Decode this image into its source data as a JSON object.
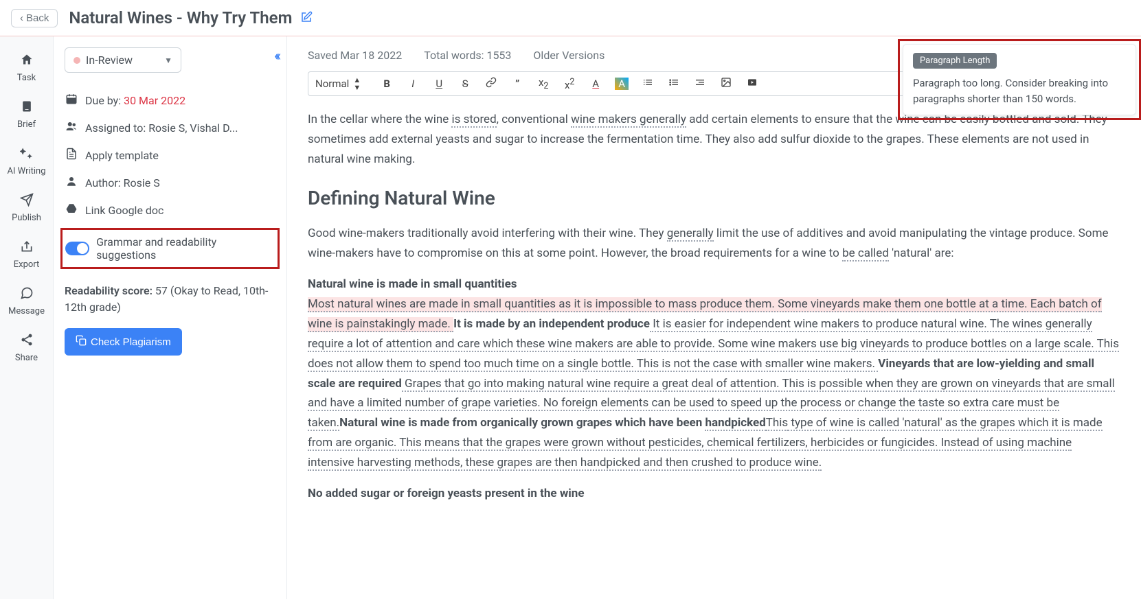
{
  "header": {
    "back_label": "Back",
    "title": "Natural Wines - Why Try Them"
  },
  "iconbar": {
    "task": "Task",
    "brief": "Brief",
    "ai_writing": "AI Writing",
    "publish": "Publish",
    "export": "Export",
    "message": "Message",
    "share": "Share"
  },
  "sidepanel": {
    "status": "In-Review",
    "due_label": "Due by: ",
    "due_date": "30 Mar 2022",
    "assigned_label": "Assigned to: ",
    "assigned_to": "Rosie S, Vishal D...",
    "apply_template": "Apply template",
    "author_label": "Author: ",
    "author": "Rosie S",
    "link_gdoc": "Link Google doc",
    "grammar_toggle": "Grammar and readability suggestions",
    "readability_label": "Readability score: ",
    "readability_value": "57 (Okay to Read, 10th-12th grade)",
    "plagiarism": "Check Plagiarism"
  },
  "editor_meta": {
    "saved": "Saved Mar 18 2022",
    "total_words": "Total words: 1553",
    "older_versions": "Older Versions"
  },
  "toolbar": {
    "style": "Normal"
  },
  "content": {
    "p1_a": "In the cellar where the wine ",
    "p1_b": "is stored",
    "p1_c": ", conventional ",
    "p1_d": "wine makers generally",
    "p1_e": " add certain elements to ensure that the wine can be easily bottled and sold. They sometimes add external yeasts and sugar to increase the fermentation time. They also add sulfur dioxide to the grapes. These elements are not used in natural wine making.",
    "h2": "Defining Natural Wine",
    "p2_a": "Good wine-makers traditionally avoid interfering with their wine. They ",
    "p2_b": "generally",
    "p2_c": " limit the use of additives and avoid manipulating the vintage produce. Some wine-makers have to compromise on this at some point. However, the broad requirements for a wine to ",
    "p2_d": "be called",
    "p2_e": " 'natural' are:",
    "p3_bold1": "Natural wine is made in small quantities",
    "p3_hl": "Most natural wines are made in small quantities as it is impossible to mass produce them. Some vineyards make them one bottle at a time. Each batch of wine is painstakingly made. ",
    "p3_bold2": "It is made by an independent produce",
    "p3_a": " It is easier for independent wine makers to produce natural wine. The wines generally require a lot of attention and care which these wine makers are able to provide. Some wine makers use big vineyards to produce bottles on a large scale. This does not allow them to spend too much time on a single bottle. This is not the case with smaller wine makers. ",
    "p3_bold3": "Vineyards that are low-yielding and small scale are required",
    "p3_b": " Grapes that go into making natural wine require a great deal of attention. This is possible when they are grown on vineyards that are small and have a limited number of grape varieties. No foreign elements can be used to speed up the process or change the taste so extra care must be ",
    "p3_c": "taken.",
    "p3_bold4": "Natural wine is made from organically grown grapes which have been ",
    "p3_bold4b": "handpicked",
    "p3_d": "This",
    "p3_e": " type of wine is called 'natural' as the grapes which it is made from are organic. This means that the grapes were grown without pesticides, chemical fertilizers, herbicides or fungicides. Instead of using machine intensive harvesting methods, these grapes are then handpicked and then crushed to produce wine.",
    "p4_bold": "No added sugar or foreign yeasts present in the wine"
  },
  "popup": {
    "badge": "Paragraph Length",
    "text": "Paragraph too long. Consider breaking into paragraphs shorter than 150 words."
  }
}
